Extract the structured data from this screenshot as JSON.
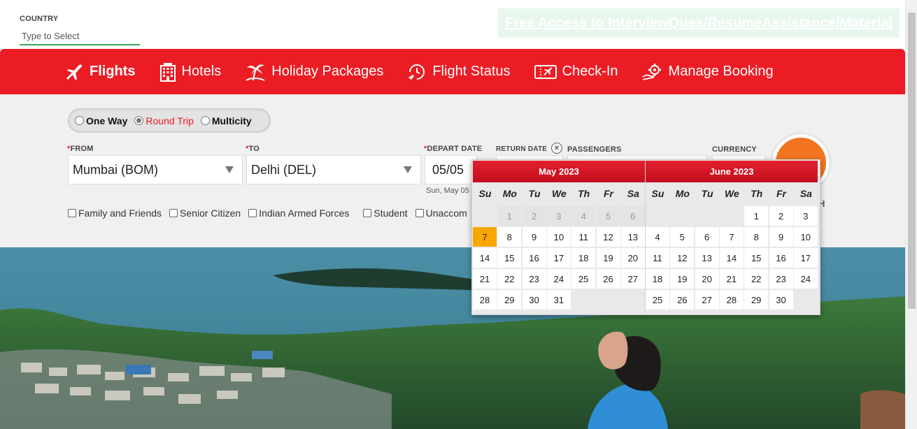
{
  "country": {
    "label": "COUNTRY",
    "placeholder": "Type to Select"
  },
  "promo": {
    "text": "Free Access to InterviewQues/ResumeAssistance/Material"
  },
  "nav": [
    {
      "label": "Flights",
      "icon": "plane-icon",
      "active": true
    },
    {
      "label": "Hotels",
      "icon": "hotel-icon"
    },
    {
      "label": "Holiday Packages",
      "icon": "palm-tree-icon"
    },
    {
      "label": "Flight Status",
      "icon": "flight-status-icon"
    },
    {
      "label": "Check-In",
      "icon": "ticket-icon"
    },
    {
      "label": "Manage Booking",
      "icon": "gear-hand-icon"
    }
  ],
  "trip_type": {
    "options": [
      "One Way",
      "Round Trip",
      "Multicity"
    ],
    "selected": "Round Trip"
  },
  "form": {
    "from_label": "FROM",
    "from_value": "Mumbai (BOM)",
    "to_label": "TO",
    "to_value": "Delhi (DEL)",
    "depart_label": "DEPART DATE",
    "depart_value": "05/05",
    "depart_sub": "Sun, May 05",
    "return_label": "RETURN DATE",
    "passengers_label": "PASSENGERS",
    "currency_label": "CURRENCY",
    "required_mark": "*",
    "clear_symbol": "×",
    "search_partial": "H"
  },
  "concessions": [
    "Family and Friends",
    "Senior Citizen",
    "Indian Armed Forces",
    "Student",
    "Unaccom"
  ],
  "calendar": {
    "weekdays": [
      "Su",
      "Mo",
      "Tu",
      "We",
      "Th",
      "Fr",
      "Sa"
    ],
    "months": [
      {
        "title": "May 2023",
        "past_days": [
          "1",
          "2",
          "3",
          "4",
          "5",
          "6"
        ],
        "selected": "7",
        "weeks": [
          [
            "",
            "1",
            "2",
            "3",
            "4",
            "5",
            "6"
          ],
          [
            "7",
            "8",
            "9",
            "10",
            "11",
            "12",
            "13"
          ],
          [
            "14",
            "15",
            "16",
            "17",
            "18",
            "19",
            "20"
          ],
          [
            "21",
            "22",
            "23",
            "24",
            "25",
            "26",
            "27"
          ],
          [
            "28",
            "29",
            "30",
            "31",
            "",
            "",
            ""
          ]
        ]
      },
      {
        "title": "June 2023",
        "past_days": [],
        "selected": "",
        "weeks": [
          [
            "",
            "",
            "",
            "",
            "1",
            "2",
            "3"
          ],
          [
            "4",
            "5",
            "6",
            "7",
            "8",
            "9",
            "10"
          ],
          [
            "11",
            "12",
            "13",
            "14",
            "15",
            "16",
            "17"
          ],
          [
            "18",
            "19",
            "20",
            "21",
            "22",
            "23",
            "24"
          ],
          [
            "25",
            "26",
            "27",
            "28",
            "29",
            "30",
            ""
          ]
        ]
      }
    ]
  },
  "colors": {
    "brand_red": "#ec1c24",
    "selected_day": "#f8a700",
    "search_orange": "#f27420",
    "country_underline": "#3aa55a"
  }
}
